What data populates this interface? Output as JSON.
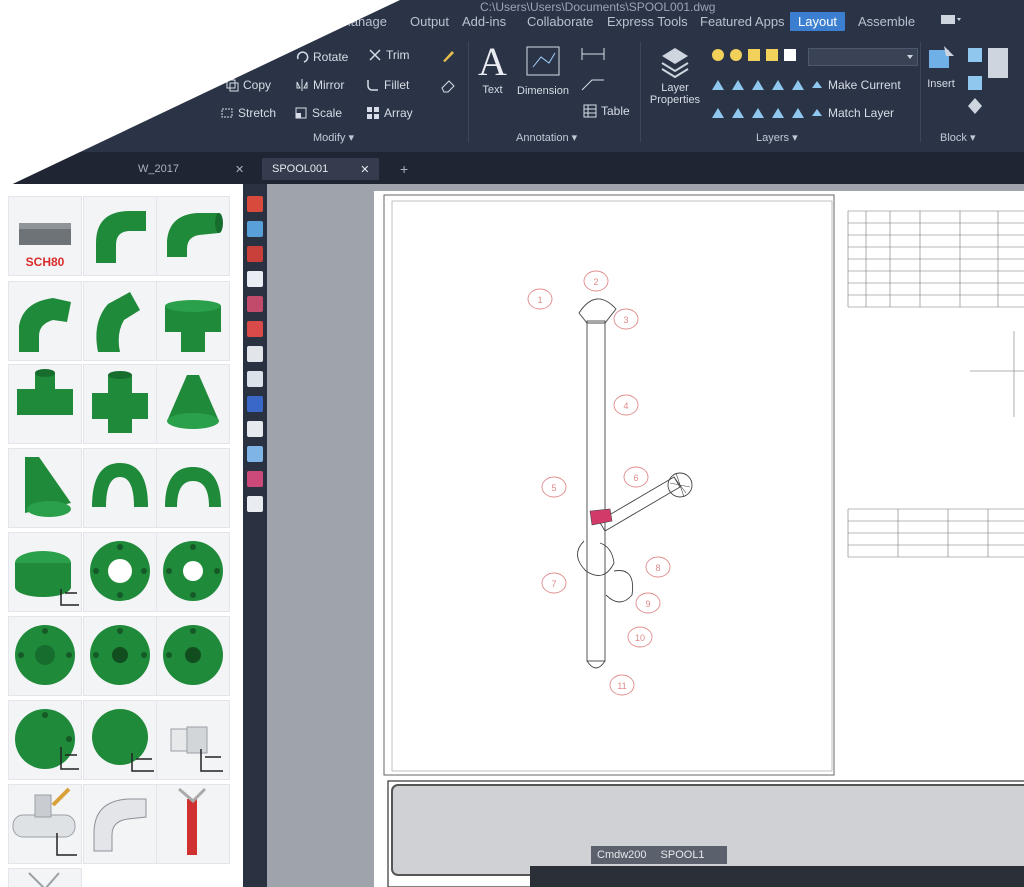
{
  "titlebar": {
    "path": "C:\\Users\\Users\\Documents\\SPOOL001.dwg"
  },
  "ribbon": {
    "tabs": [
      "Manage",
      "Output",
      "Add-ins",
      "Collaborate",
      "Express Tools",
      "Featured Apps",
      "Layout",
      "Assemble"
    ],
    "active_tab": "Layout",
    "modify": {
      "move": "Rotate",
      "trim": "Trim",
      "copy": "Copy",
      "mirror": "Mirror",
      "fillet": "Fillet",
      "stretch": "Stretch",
      "scale": "Scale",
      "array": "Array",
      "panel_label": "Modify ▾"
    },
    "annotation": {
      "text": "Text",
      "dimension": "Dimension",
      "table": "Table",
      "panel_label": "Annotation ▾"
    },
    "layers": {
      "layer_properties": "Layer Properties",
      "make_current": "Make Current",
      "match_layer": "Match Layer",
      "panel_label": "Layers ▾"
    },
    "block": {
      "insert": "Insert",
      "panel_label": "Block ▾"
    }
  },
  "doc_tabs": [
    {
      "label": "W_2017",
      "active": false
    },
    {
      "label": "SPOOL001",
      "active": true
    }
  ],
  "palette": {
    "first_tile_label": "SCH80",
    "tiles": [
      "pipe-sch80",
      "elbow-90",
      "elbow-90-short",
      "elbow-45",
      "elbow-lateral",
      "tee",
      "tee-reducing",
      "cross",
      "reducer-concentric",
      "reducer-eccentric",
      "return-bend-180",
      "return-bend-long",
      "cap-flanged",
      "flange-weldneck",
      "flange-slipon",
      "flange-blind",
      "flange-socket",
      "flange-lapjoint",
      "flange-threaded",
      "coupling",
      "branch-outlet",
      "branch-outlet-2",
      "elbow-bent",
      "valve-stem",
      "reducer-small"
    ]
  },
  "drawing": {
    "balloons": [
      "1",
      "2",
      "3",
      "4",
      "5",
      "6",
      "7",
      "8",
      "9",
      "10",
      "11"
    ],
    "bom_table_rows": 8,
    "cut_table_rows": 3
  },
  "command": {
    "label": "Cmdw200",
    "value": "SPOOL1"
  },
  "colors": {
    "ribbon": "#2b3446",
    "fitting_green": "#1f8a3a",
    "active_tab": "#3c7fd1",
    "balloon": "#e08a8a"
  }
}
